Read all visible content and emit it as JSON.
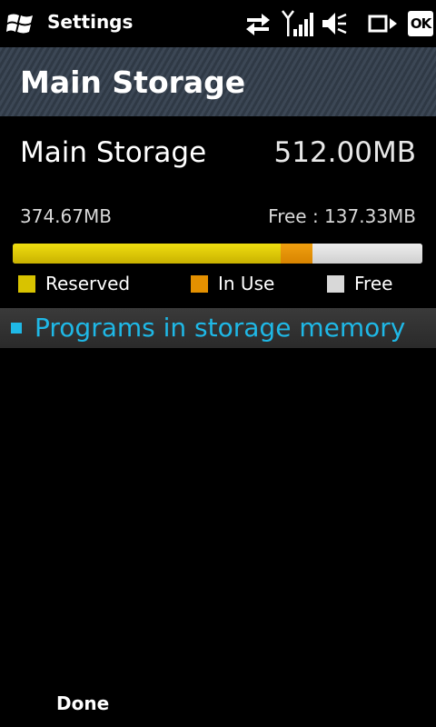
{
  "status_bar": {
    "title": "Settings",
    "ok_label": "OK",
    "icons": [
      "windows-logo-icon",
      "data-transfer-icon",
      "signal-strength-icon",
      "speaker-muted-icon",
      "connection-icon",
      "ok-button-icon"
    ]
  },
  "header": {
    "title": "Main Storage"
  },
  "storage": {
    "name": "Main Storage",
    "total": "512.00MB",
    "reserved_text": "374.67MB",
    "free_text": "Free : 137.33MB",
    "usage_fractions": {
      "reserved": 0.653,
      "in_use": 0.079,
      "free": 0.268
    },
    "colors": {
      "reserved": "#d8c300",
      "in_use": "#e49000",
      "free": "#d8d8d8"
    }
  },
  "legend": [
    {
      "label": "Reserved",
      "color": "#d8c300"
    },
    {
      "label": "In Use",
      "color": "#e49000"
    },
    {
      "label": "Free",
      "color": "#d8d8d8"
    }
  ],
  "programs_link": {
    "label": "Programs in storage memory",
    "color": "#1fb8e6"
  },
  "softkeys": {
    "left": "Done"
  }
}
